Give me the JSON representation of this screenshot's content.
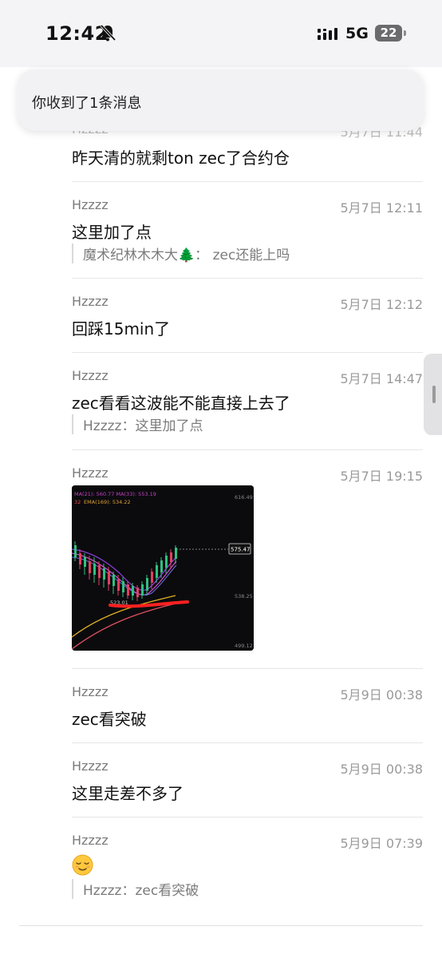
{
  "status_bar": {
    "time": "12:42",
    "network": "5G",
    "battery": "22"
  },
  "notification": {
    "text": "你收到了1条消息"
  },
  "messages": [
    {
      "sender": "Hzzzz",
      "time": "5月7日 11:44",
      "text": "昨天清的就剩ton zec了合约仓"
    },
    {
      "sender": "Hzzzz",
      "time": "5月7日 12:11",
      "text": "这里加了点",
      "quote": "魔术纪林木木大🌲：  zec还能上吗"
    },
    {
      "sender": "Hzzzz",
      "time": "5月7日 12:12",
      "text": "回踩15min了"
    },
    {
      "sender": "Hzzzz",
      "time": "5月7日 14:47",
      "text": "zec看看这波能不能直接上去了",
      "quote": "Hzzzz：这里加了点"
    },
    {
      "sender": "Hzzzz",
      "time": "5月7日 19:15",
      "image": {
        "legend_ma": "MA(21): 560.77   MA(33): 553.19",
        "legend_ema_prefix": "32",
        "legend_ema": "EMA(169): 534.22",
        "price_top": "616.49",
        "price_current": "575.47",
        "price_mid": "538.25",
        "price_bottom": "499.12",
        "price_low_label": "523.01"
      }
    },
    {
      "sender": "Hzzzz",
      "time": "5月9日 00:38",
      "text": "zec看突破"
    },
    {
      "sender": "Hzzzz",
      "time": "5月9日 00:38",
      "text": "这里走差不多了"
    },
    {
      "sender": "Hzzzz",
      "time": "5月9日 07:39",
      "emoji": "relieved-face",
      "quote": "Hzzzz：zec看突破"
    }
  ]
}
